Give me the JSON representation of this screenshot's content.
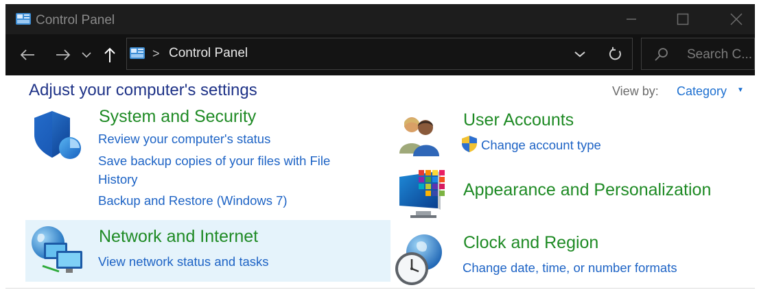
{
  "window": {
    "title": "Control Panel"
  },
  "addressbar": {
    "separator": ">",
    "path": "Control Panel"
  },
  "search": {
    "placeholder": "Search C..."
  },
  "content": {
    "heading": "Adjust your computer's settings",
    "view_by_label": "View by:",
    "view_by_value": "Category"
  },
  "categories": [
    {
      "title": "System and Security",
      "links": [
        "Review your computer's status",
        "Save backup copies of your files with File",
        "History",
        "Backup and Restore (Windows 7)"
      ]
    },
    {
      "title": "Network and Internet",
      "links": [
        "View network status and tasks"
      ]
    },
    {
      "title": "User Accounts",
      "links": [
        "Change account type"
      ]
    },
    {
      "title": "Appearance and Personalization",
      "links": []
    },
    {
      "title": "Clock and Region",
      "links": [
        "Change date, time, or number formats"
      ]
    }
  ],
  "colors": {
    "titlebar_bg": "#1d1d1d",
    "address_row_bg": "#121212",
    "heading": "#1e3287",
    "category_title": "#1e8a24",
    "link": "#1d63c5",
    "hover_highlight": "#e5f3fb"
  },
  "icons": {
    "app": "control-panel-icon",
    "back": "back-arrow-icon",
    "forward": "forward-arrow-icon",
    "recent": "chevron-down-icon",
    "up": "up-arrow-icon",
    "refresh": "refresh-icon",
    "search": "search-icon",
    "system_security": "shield-icon",
    "network": "network-globe-icon",
    "user_accounts": "users-icon",
    "uac": "uac-shield-icon",
    "appearance": "monitor-palette-icon",
    "clock_region": "clock-globe-icon"
  }
}
